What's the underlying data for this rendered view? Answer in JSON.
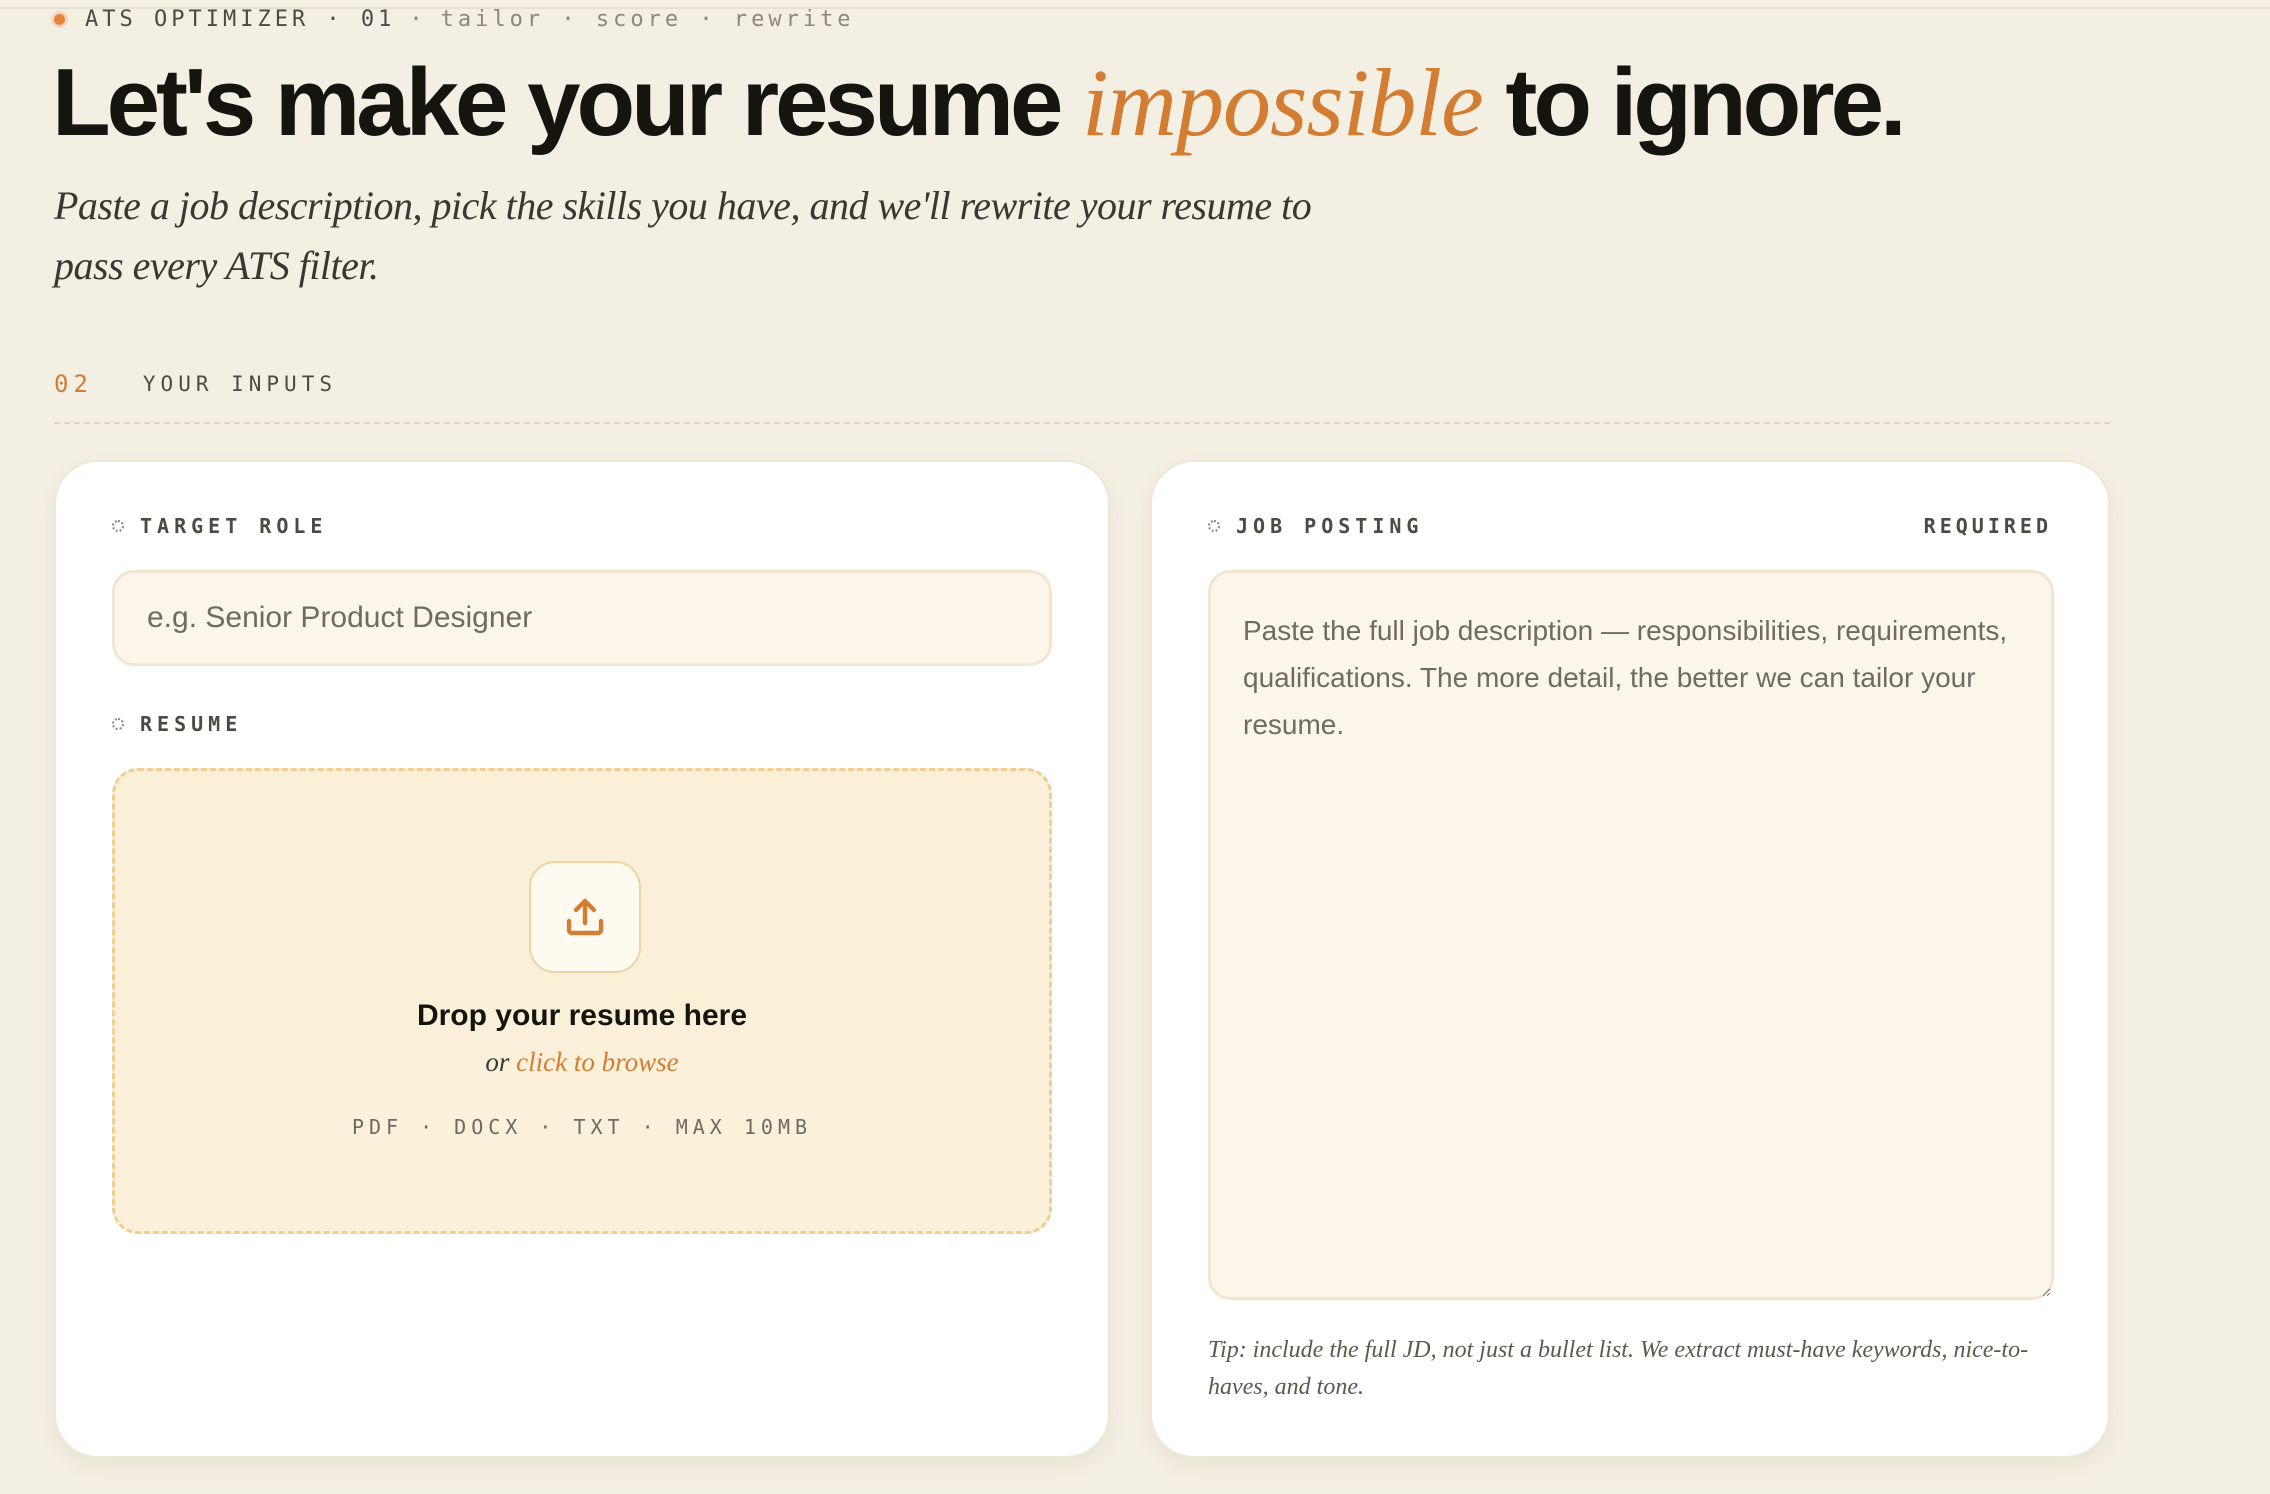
{
  "eyebrow": {
    "app": "ATS OPTIMIZER · 01",
    "sep": "·",
    "steps": "tailor · score · rewrite"
  },
  "hero": {
    "headline_before": "Let's make your resume ",
    "headline_accent": "impossible",
    "headline_after": " to ignore.",
    "subhead": "Paste a job description, pick the skills you have, and we'll rewrite your resume to pass every ATS filter."
  },
  "section": {
    "number": "02",
    "title": "YOUR INPUTS"
  },
  "inputs": {
    "target_role": {
      "label": "TARGET ROLE",
      "placeholder": "e.g. Senior Product Designer"
    },
    "resume": {
      "label": "RESUME",
      "upload_icon": "upload-icon",
      "drop_title": "Drop your resume here",
      "drop_or": "or ",
      "browse_link": "click to browse",
      "formats": "PDF · DOCX · TXT · MAX 10MB"
    },
    "job_posting": {
      "label": "JOB POSTING",
      "required": "REQUIRED",
      "placeholder": "Paste the full job description — responsibilities, requirements, qualifications. The more detail, the better we can tailor your resume.",
      "tip": "Tip: include the full JD, not just a bullet list. We extract must-have keywords, nice-to-haves, and tone."
    }
  },
  "colors": {
    "accent": "#d27d32",
    "background": "#f4efe3",
    "card": "#ffffff"
  }
}
